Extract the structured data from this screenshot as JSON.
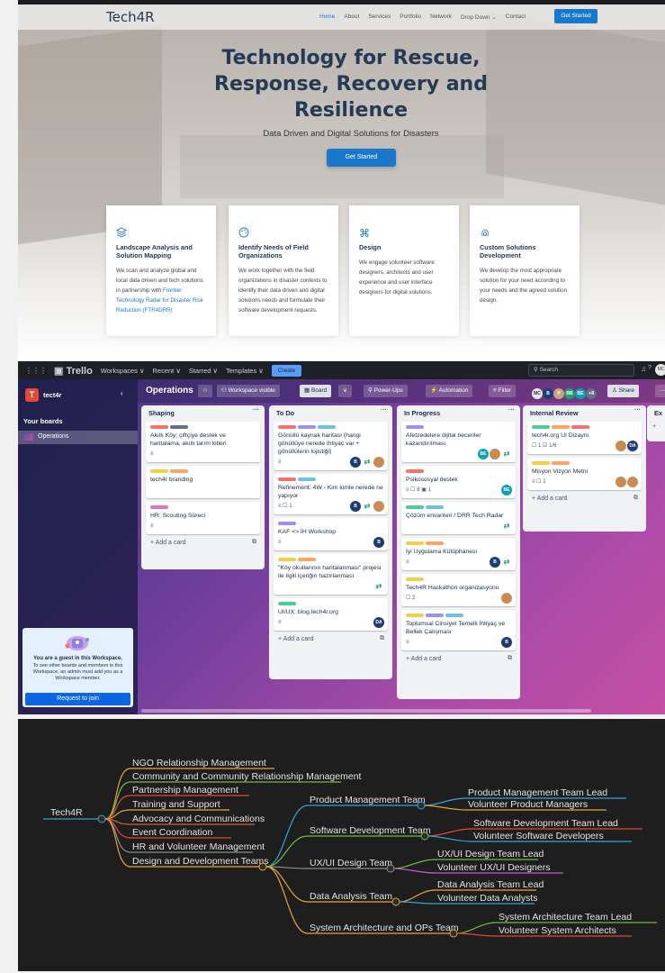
{
  "website": {
    "logo": "Tech4R",
    "nav": [
      "Home",
      "About",
      "Services",
      "Portfolio",
      "Network",
      "Drop Down ⌄",
      "Contact"
    ],
    "nav_button": "Get Started",
    "hero_title": "Technology for Rescue, Response, Recovery and Resilience",
    "hero_subtitle": "Data Driven and Digital Solutions for Disasters",
    "hero_button": "Get Started",
    "cards": [
      {
        "icon": "layers-icon",
        "title": "Landscape Analysis and Solution Mapping",
        "desc": "We scan and analyze global and local data driven and tech solutions in partnership with ",
        "link": "Frontier Technology Radar for Disaster Risk Reduction (FTR4DRR)"
      },
      {
        "icon": "palette-icon",
        "title": "Identify Needs of Field Organizations",
        "desc": "We work together with the field organizations in disaster contexts to identify their data driven and digital solutions needs and formulate their software development requests.",
        "link": ""
      },
      {
        "icon": "command-icon",
        "title": "Design",
        "desc": "We engage volunteer software designers, architects and user experience and user interface designers for digital solutions.",
        "link": ""
      },
      {
        "icon": "fingerprint-icon",
        "title": "Custom Solutions Development",
        "desc": "We develop the most appropriate solution for your need according to your needs and the agreed solution design.",
        "link": ""
      }
    ]
  },
  "trello": {
    "logo": "Trello",
    "menu": [
      "Workspaces ∨",
      "Recent ∨",
      "Starred ∨",
      "Templates ∨"
    ],
    "create": "Create",
    "search_placeholder": "Search",
    "user_initials": "MC",
    "workspace_initial": "T",
    "workspace_name": "tect4r",
    "your_boards": "Your boards",
    "board_item": "Operations",
    "guest_title": "You are a guest in this Workspace.",
    "guest_desc": "To see other boards and members in this Workspace, an admin must add you as a Workspace member.",
    "guest_button": "Request to join",
    "board_title": "Operations",
    "visibility": "Workspace visible",
    "view": "Board",
    "powerups": "Power-Ups",
    "automation": "Automation",
    "filter": "Filter",
    "member_more": "+8",
    "share": "Share",
    "add_card": "+ Add a card",
    "lists": [
      {
        "name": "Shaping",
        "cards": [
          {
            "labels": [
              "#f87168",
              "#626f86"
            ],
            "title": "Akıllı Köy: çiftçiye destek ve haritalama, akıllı tarım kitleri",
            "badges": "≡",
            "avatars": []
          },
          {
            "labels": [
              "#f5cd47",
              "#fea362"
            ],
            "title": "tech4r branding",
            "badges": "",
            "avatars": []
          },
          {
            "labels": [
              "#e774bb"
            ],
            "title": "HR: Scouting Süreci",
            "badges": "≡",
            "avatars": []
          }
        ]
      },
      {
        "name": "To Do",
        "cards": [
          {
            "labels": [
              "#f87168",
              "#9f8fef",
              "#6cc3e0"
            ],
            "title": "Gönüllü kaynak haritası (hangi gönüllüye nerede ihtiyaç var + gönüllülerin lojistiği)",
            "badges": "≡",
            "avatars": [
              "B",
              "⇄",
              "P"
            ]
          },
          {
            "labels": [
              "#f87168",
              "#6cc3e0"
            ],
            "title": "Refinement: 4W - Kim kimle nerede ne yapıyor",
            "badges": "≡  ☐ 1",
            "avatars": [
              "B",
              "⇄",
              "P"
            ]
          },
          {
            "labels": [
              "#9f8fef"
            ],
            "title": "KAF <> İH Workshop",
            "badges": "≡",
            "avatars": [
              "B"
            ]
          },
          {
            "labels": [
              "#f5cd47",
              "#fea362"
            ],
            "title": "\"Köy okullarının haritalanması\" projesi ile ilgili içeriğin hazırlanması",
            "badges": "",
            "avatars": [
              "⇄"
            ]
          },
          {
            "labels": [
              "#4bce97"
            ],
            "title": "UI/UX: blog.tech4r.org",
            "badges": "≡",
            "avatars": [
              "DA"
            ]
          }
        ]
      },
      {
        "name": "In Progress",
        "cards": [
          {
            "labels": [
              "#9f8fef"
            ],
            "title": "Afetzedelere dijital beceriler kazandırılması.",
            "badges": "",
            "avatars": [
              "BE",
              "P",
              "⇄"
            ]
          },
          {
            "labels": [
              "#f87168"
            ],
            "title": "Psikososyal destek",
            "badges": "≡  ☐ 8  ▣ 1",
            "avatars": [
              "BE"
            ]
          },
          {
            "labels": [
              "#4bce97",
              "#6cc3e0"
            ],
            "title": "Çözüm envanteri / DRR Tech Radar",
            "badges": "",
            "avatars": [
              "⇄"
            ]
          },
          {
            "labels": [
              "#f5cd47",
              "#fea362"
            ],
            "title": "İyi Uygulama Kütüphanesi",
            "badges": "≡",
            "avatars": [
              "B",
              "⇄"
            ]
          },
          {
            "labels": [
              "#f5cd47"
            ],
            "title": "Tech4R Hackathon organizasyonu",
            "badges": "☐ 2",
            "avatars": [
              "P"
            ]
          },
          {
            "labels": [
              "#f5cd47",
              "#9f8fef",
              "#6cc3e0"
            ],
            "title": "Toplumsal Cinsiyet Temelli İhtiyaç ve Bellek Çalışması",
            "badges": "≡",
            "avatars": [
              "B"
            ]
          }
        ]
      },
      {
        "name": "Internal Review",
        "cards": [
          {
            "labels": [
              "#4bce97",
              "#fea362",
              "#f87168"
            ],
            "title": "tech4r.org UI Dizaynı",
            "badges": "☐ 1  ☑ 1/6",
            "avatars": [
              "P",
              "DA"
            ]
          },
          {
            "labels": [
              "#f5cd47",
              "#fea362"
            ],
            "title": "Misyon Vizyon Metni",
            "badges": "≡  ☐ 1",
            "avatars": [
              "P",
              "P"
            ]
          }
        ]
      },
      {
        "name": "Ex",
        "cards": []
      }
    ]
  },
  "mindmap": {
    "root": "Tech4R",
    "branches": [
      {
        "label": "NGO Relationship Management",
        "color": "#e8a33d"
      },
      {
        "label": "Community and Community Relationship Management",
        "color": "#6bbf3f"
      },
      {
        "label": "Partnership Management",
        "color": "#e34935"
      },
      {
        "label": "Training and Support",
        "color": "#e8a33d"
      },
      {
        "label": "Advocacy and Communications",
        "color": "#c86a3c"
      },
      {
        "label": "Event Coordination",
        "color": "#e34935"
      },
      {
        "label": "HR and Volunteer Management",
        "color": "#8c8c8c"
      },
      {
        "label": "Design and Development Teams",
        "color": "#e8a33d"
      }
    ],
    "teams": [
      {
        "label": "Product Management Team",
        "color": "#2fa6d8",
        "children": [
          {
            "label": "Product Management Team Lead",
            "color": "#2fa6d8"
          },
          {
            "label": "Volunteer Product Managers",
            "color": "#e8a33d"
          }
        ]
      },
      {
        "label": "Software Development Team",
        "color": "#6bbf3f",
        "children": [
          {
            "label": "Software Development Team Lead",
            "color": "#e34935"
          },
          {
            "label": "Volunteer Software Developers",
            "color": "#2fa6d8"
          }
        ]
      },
      {
        "label": "UX/UI Design Team",
        "color": "#8c8c8c",
        "children": [
          {
            "label": "UX/UI Design Team Lead",
            "color": "#6bbf3f"
          },
          {
            "label": "Volunteer UX/UI Designers",
            "color": "#c15ad6"
          }
        ]
      },
      {
        "label": "Data Analysis Team",
        "color": "#e8a33d",
        "children": [
          {
            "label": "Data Analysis Team Lead",
            "color": "#e8a33d"
          },
          {
            "label": "Volunteer Data Analysts",
            "color": "#2fa6d8"
          }
        ]
      },
      {
        "label": "System Architecture and OPs Team",
        "color": "#e8a33d",
        "children": [
          {
            "label": "System Architecture Team Lead",
            "color": "#6bbf3f"
          },
          {
            "label": "Volunteer System Architects",
            "color": "#e34935"
          }
        ]
      }
    ]
  }
}
